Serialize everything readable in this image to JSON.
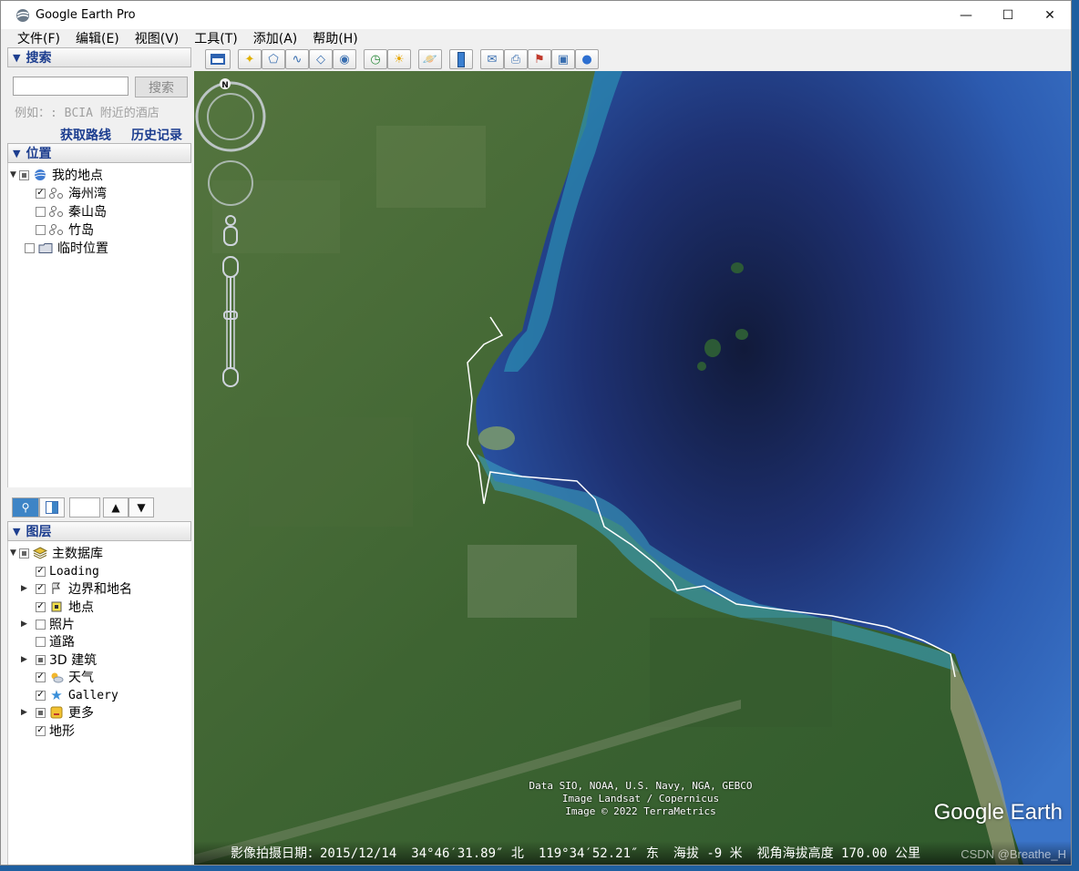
{
  "window": {
    "title": "Google Earth Pro",
    "minimize": "—",
    "maximize": "☐",
    "close": "✕"
  },
  "menu": [
    "文件(F)",
    "编辑(E)",
    "视图(V)",
    "工具(T)",
    "添加(A)",
    "帮助(H)"
  ],
  "search": {
    "header": "搜索",
    "button": "搜索",
    "input_value": "",
    "hint": "例如：: BCIA 附近的酒店",
    "link_directions": "获取路线",
    "link_history": "历史记录"
  },
  "places": {
    "header": "位置",
    "items": [
      {
        "label": "我的地点",
        "state": "partial"
      },
      {
        "label": "海州湾",
        "state": "checked"
      },
      {
        "label": "秦山岛",
        "state": "unchecked"
      },
      {
        "label": "竹岛",
        "state": "unchecked"
      },
      {
        "label": "临时位置",
        "state": "unchecked"
      }
    ]
  },
  "layers": {
    "header": "图层",
    "items": [
      {
        "label": "主数据库",
        "state": "partial"
      },
      {
        "label": "Loading",
        "state": "checked"
      },
      {
        "label": "边界和地名",
        "state": "checked"
      },
      {
        "label": "地点",
        "state": "checked"
      },
      {
        "label": "照片",
        "state": "unchecked"
      },
      {
        "label": "道路",
        "state": "unchecked"
      },
      {
        "label": "3D 建筑",
        "state": "partial"
      },
      {
        "label": "天气",
        "state": "checked"
      },
      {
        "label": "Gallery",
        "state": "checked"
      },
      {
        "label": "更多",
        "state": "partial"
      },
      {
        "label": "地形",
        "state": "checked"
      }
    ]
  },
  "map": {
    "attribution": [
      "Data SIO, NOAA, U.S. Navy, NGA, GEBCO",
      "Image Landsat / Copernicus",
      "Image © 2022 TerraMetrics"
    ],
    "logo": "Google Earth",
    "compass_label": "N",
    "status": {
      "date_label": "影像拍摄日期：2015/12/14",
      "lat": "34°46′31.89″ 北",
      "lon": "119°34′52.21″ 东",
      "elevation": "海拔   -9 米",
      "eye_alt": "视角海拔高度 170.00 公里"
    },
    "watermark": "CSDN @Breathe_H"
  },
  "colors": {
    "accent_blue": "#1d3e8f",
    "sea_deep": "#1a2350",
    "sea_mid": "#2f5fb0",
    "land": "#3f6a36"
  }
}
